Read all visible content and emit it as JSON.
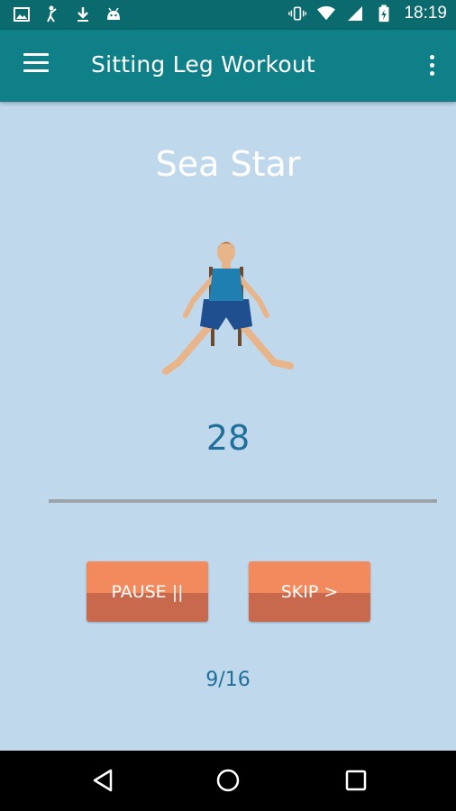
{
  "status_bar": {
    "time": "18:19",
    "left_icons": [
      "image-icon",
      "golf-icon",
      "download-icon",
      "android-icon"
    ],
    "right_icons": [
      "vibrate-icon",
      "wifi-icon",
      "signal-icon",
      "battery-charging-icon"
    ]
  },
  "app_bar": {
    "title": "Sitting Leg Workout",
    "menu_icon": "hamburger-menu-icon",
    "overflow_icon": "more-vert-icon"
  },
  "exercise": {
    "name": "Sea Star",
    "timer": "28",
    "progress_fraction": 0
  },
  "controls": {
    "pause_label": "PAUSE ||",
    "skip_label": "SKIP >"
  },
  "step": "9/16",
  "nav_bar": {
    "icons": [
      "back-icon",
      "home-icon",
      "recents-icon"
    ]
  },
  "colors": {
    "status_bar": "#0a6a6d",
    "app_bar": "#0f8087",
    "background": "#c0d8ec",
    "accent_text": "#1e6f99",
    "button_top": "#f38a5e",
    "button_bottom": "#c8694d"
  }
}
